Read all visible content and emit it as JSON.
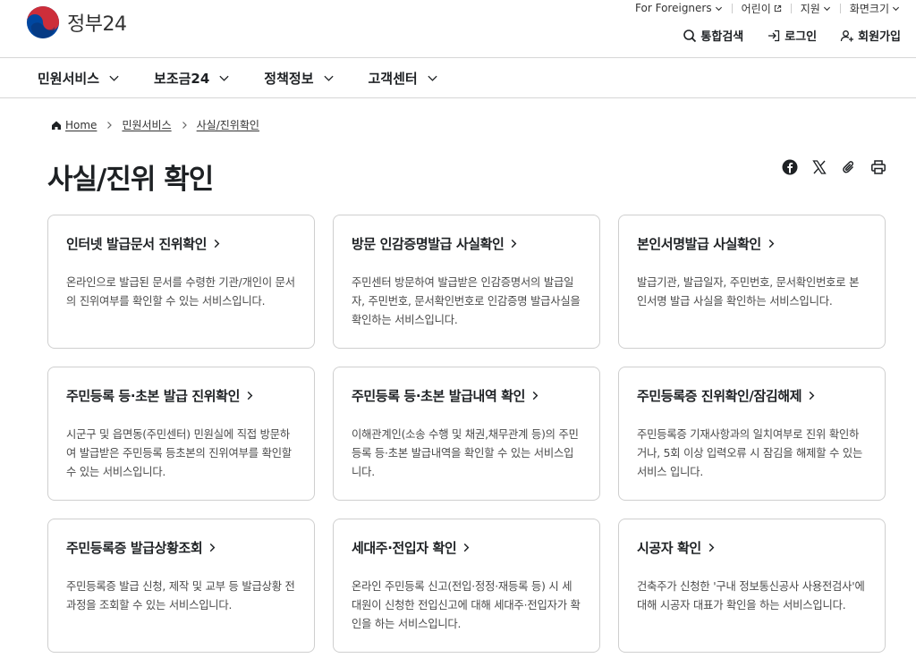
{
  "header": {
    "logo_text": "정부24",
    "util_links": [
      {
        "label": "For Foreigners",
        "icon": "chevron-down-icon"
      },
      {
        "label": "어린이",
        "icon": "external-link-icon"
      },
      {
        "label": "지원",
        "icon": "chevron-down-icon"
      },
      {
        "label": "화면크기",
        "icon": "chevron-down-icon"
      }
    ],
    "search_label": "통합검색",
    "login_label": "로그인",
    "signup_label": "회원가입"
  },
  "gnb": {
    "items": [
      {
        "label": "민원서비스"
      },
      {
        "label": "보조금24"
      },
      {
        "label": "정책정보"
      },
      {
        "label": "고객센터"
      }
    ]
  },
  "breadcrumb": {
    "home": "Home",
    "level1": "민원서비스",
    "level2": "사실/진위확인"
  },
  "page": {
    "title": "사실/진위 확인"
  },
  "share_tools": [
    "facebook-icon",
    "x-icon",
    "link-icon",
    "print-icon"
  ],
  "cards": [
    {
      "title": "인터넷 발급문서 진위확인",
      "desc": "온라인으로 발급된 문서를 수령한 기관/개인이 문서의 진위여부를 확인할 수 있는 서비스입니다."
    },
    {
      "title": "방문 인감증명발급 사실확인",
      "desc": "주민센터 방문하여 발급받은 인감증명서의 발급일자, 주민번호, 문서확인번호로 인감증명 발급사실을 확인하는 서비스입니다."
    },
    {
      "title": "본인서명발급 사실확인",
      "desc": "발급기관, 발급일자, 주민번호, 문서확인번호로 본인서명 발급 사실을 확인하는 서비스입니다."
    },
    {
      "title": "주민등록 등·초본 발급 진위확인",
      "desc": "시군구 및 읍면동(주민센터) 민원실에 직접 방문하여 발급받은 주민등록 등초본의 진위여부를 확인할 수 있는 서비스입니다."
    },
    {
      "title": "주민등록 등·초본 발급내역 확인",
      "desc": "이해관계인(소송 수행 및 채권,채무관계 등)의 주민등록 등·초본 발급내역을 확인할 수 있는 서비스입니다."
    },
    {
      "title": "주민등록증 진위확인/잠김해제",
      "desc": "주민등록증 기재사항과의 일치여부로 진위 확인하거나, 5회 이상 입력오류 시 잠김을 해제할 수 있는 서비스 입니다."
    },
    {
      "title": "주민등록증 발급상황조회",
      "desc": "주민등록증 발급 신청, 제작 및 교부 등 발급상황 전 과정을 조회할 수 있는 서비스입니다."
    },
    {
      "title": "세대주·전입자 확인",
      "desc": "온라인 주민등록 신고(전입·정정·재등록 등) 시 세대원이 신청한 전입신고에 대해 세대주·전입자가 확인을 하는 서비스입니다."
    },
    {
      "title": "시공자 확인",
      "desc": "건축주가 신청한 '구내 정보통신공사 사용전검사'에 대해 시공자 대표가 확인을 하는 서비스입니다."
    }
  ],
  "colors": {
    "logo_red": "#cd2e3a",
    "logo_blue": "#0047a0",
    "text": "#1e2124",
    "border": "#cfcfcf"
  }
}
